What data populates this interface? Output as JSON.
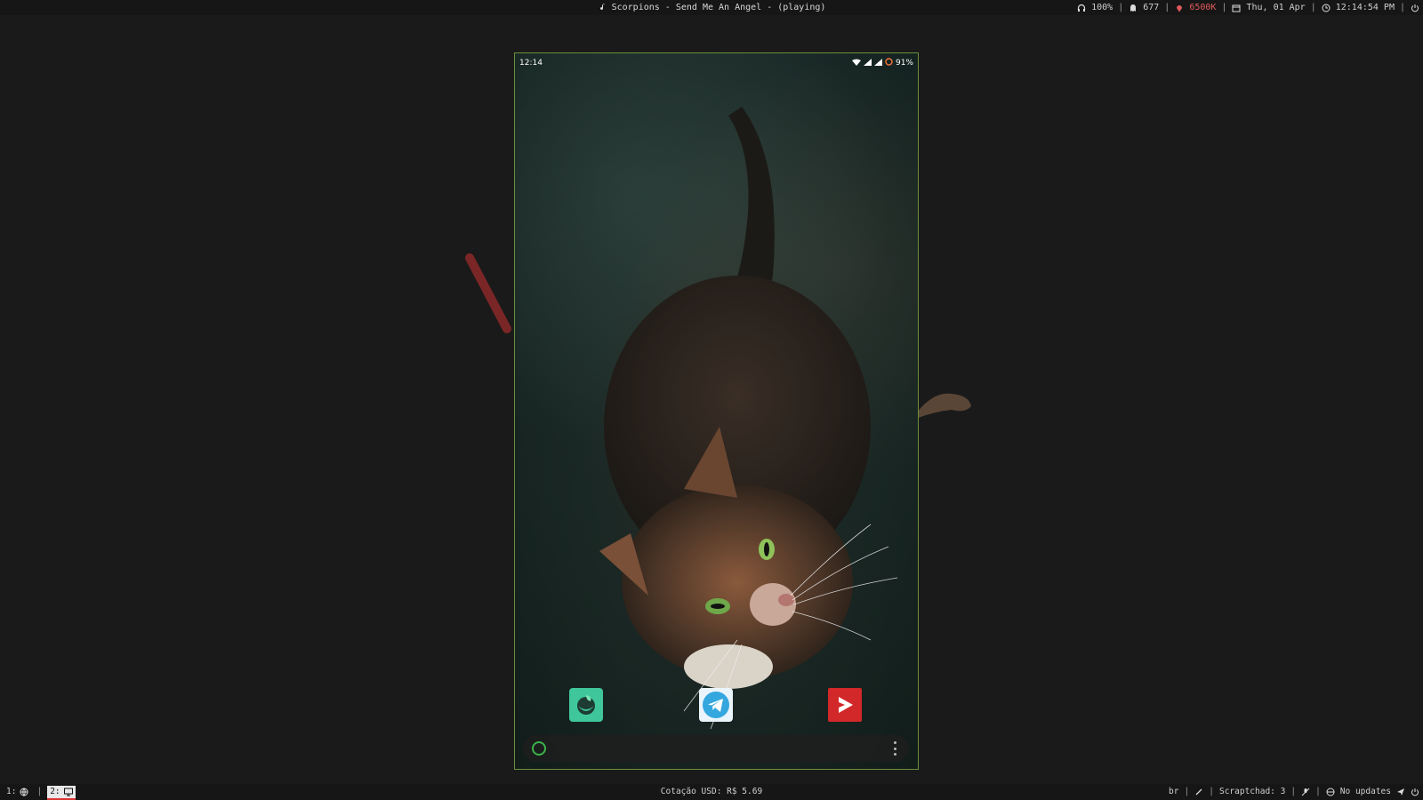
{
  "topbar": {
    "now_playing": "Scorpions - Send Me An Angel - (playing)",
    "volume": "100%",
    "mail_count": "677",
    "color_temp": "6500K",
    "date": "Thu, 01 Apr",
    "time": "12:14:54 PM"
  },
  "bottombar": {
    "workspaces": [
      {
        "label": "1:",
        "icon": "globe-icon",
        "active": false
      },
      {
        "label": "2:",
        "icon": "monitor-icon",
        "active": true
      }
    ],
    "quote": "Cotação USD: R$ 5.69",
    "keyboard_layout": "br",
    "scratchpad": "Scraptchad: 3",
    "updates": "No updates"
  },
  "phone": {
    "time": "12:14",
    "battery": "91%",
    "apps": [
      {
        "name": "green-app",
        "icon": "globe-leaf-icon"
      },
      {
        "name": "telegram",
        "icon": "telegram-icon"
      },
      {
        "name": "youtube-vanced",
        "icon": "play-icon"
      }
    ]
  },
  "colors": {
    "accent_red": "#e05a5a",
    "phone_border": "#6b8f3a",
    "search_ring": "#3bb34a"
  }
}
